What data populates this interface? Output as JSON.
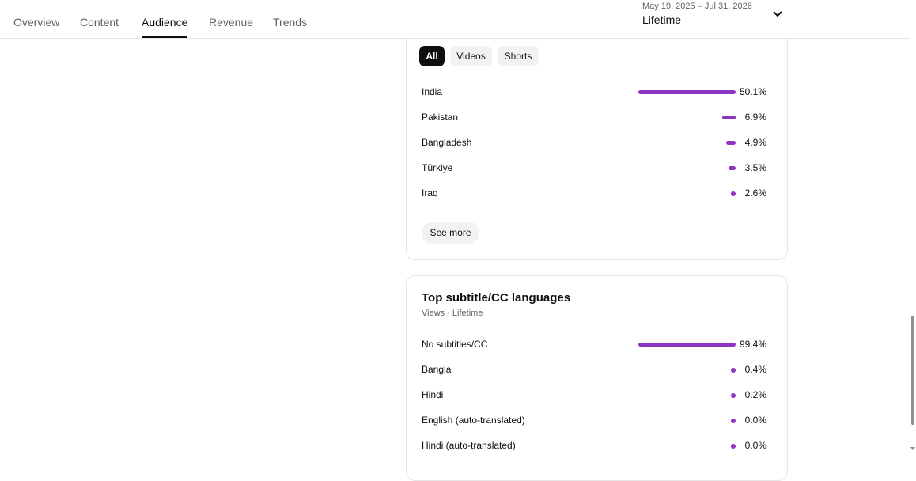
{
  "tabs": [
    {
      "label": "Overview",
      "active": false
    },
    {
      "label": "Content",
      "active": false
    },
    {
      "label": "Audience",
      "active": true
    },
    {
      "label": "Revenue",
      "active": false
    },
    {
      "label": "Trends",
      "active": false
    }
  ],
  "date_range": {
    "range": "May 19, 2025 – Jul 31, 2026",
    "period": "Lifetime"
  },
  "geography_card": {
    "filters": [
      {
        "label": "All",
        "selected": true
      },
      {
        "label": "Videos",
        "selected": false
      },
      {
        "label": "Shorts",
        "selected": false
      }
    ],
    "rows": [
      {
        "label": "India",
        "value": "50.1%",
        "fraction": 0.501
      },
      {
        "label": "Pakistan",
        "value": "6.9%",
        "fraction": 0.069
      },
      {
        "label": "Bangladesh",
        "value": "4.9%",
        "fraction": 0.049
      },
      {
        "label": "Türkiye",
        "value": "3.5%",
        "fraction": 0.035
      },
      {
        "label": "Iraq",
        "value": "2.6%",
        "fraction": 0.026
      }
    ],
    "see_more_label": "See more"
  },
  "subtitle_card": {
    "title": "Top subtitle/CC languages",
    "subtitle": "Views · Lifetime",
    "rows": [
      {
        "label": "No subtitles/CC",
        "value": "99.4%",
        "fraction": 0.994
      },
      {
        "label": "Bangla",
        "value": "0.4%",
        "fraction": 0.004
      },
      {
        "label": "Hindi",
        "value": "0.2%",
        "fraction": 0.002
      },
      {
        "label": "English (auto-translated)",
        "value": "0.0%",
        "fraction": 0.0
      },
      {
        "label": "Hindi (auto-translated)",
        "value": "0.0%",
        "fraction": 0.0
      }
    ]
  },
  "colors": {
    "accent_bar": "#8e34c2",
    "active_tab_underline": "#0f0f0f"
  }
}
